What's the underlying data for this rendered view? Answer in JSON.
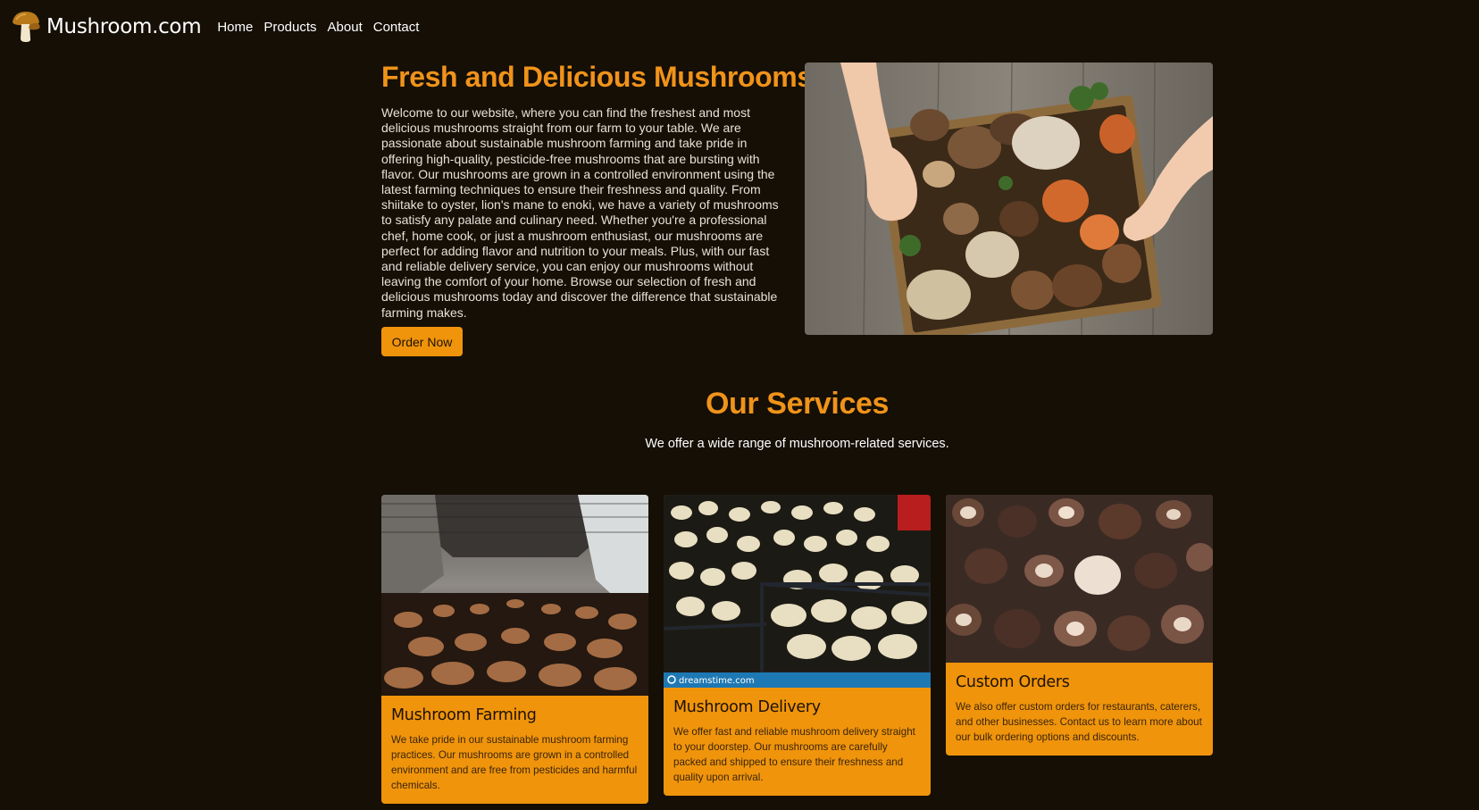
{
  "nav": {
    "brand": "Mushroom.com",
    "links": [
      "Home",
      "Products",
      "About",
      "Contact"
    ]
  },
  "hero": {
    "title": "Fresh and Delicious Mushrooms",
    "text": "Welcome to our website, where you can find the freshest and most delicious mushrooms straight from our farm to your table. We are passionate about sustainable mushroom farming and take pride in offering high-quality, pesticide-free mushrooms that are bursting with flavor. Our mushrooms are grown in a controlled environment using the latest farming techniques to ensure their freshness and quality. From shiitake to oyster, lion's mane to enoki, we have a variety of mushrooms to satisfy any palate and culinary need. Whether you're a professional chef, home cook, or just a mushroom enthusiast, our mushrooms are perfect for adding flavor and nutrition to your meals. Plus, with our fast and reliable delivery service, you can enjoy our mushrooms without leaving the comfort of your home. Browse our selection of fresh and delicious mushrooms today and discover the difference that sustainable farming makes.",
    "button": "Order Now"
  },
  "services": {
    "title": "Our Services",
    "subtitle": "We offer a wide range of mushroom-related services.",
    "cards": [
      {
        "title": "Mushroom Farming",
        "text": "We take pride in our sustainable mushroom farming practices. Our mushrooms are grown in a controlled environment and are free from pesticides and harmful chemicals."
      },
      {
        "title": "Mushroom Delivery",
        "text": "We offer fast and reliable mushroom delivery straight to your doorstep. Our mushrooms are carefully packed and shipped to ensure their freshness and quality upon arrival.",
        "watermark": "dreamstime.com"
      },
      {
        "title": "Custom Orders",
        "text": "We also offer custom orders for restaurants, caterers, and other businesses. Contact us to learn more about our bulk ordering options and discounts."
      }
    ]
  },
  "colors": {
    "background": "#150f05",
    "accent": "#f0931a",
    "card": "#f0940c"
  }
}
